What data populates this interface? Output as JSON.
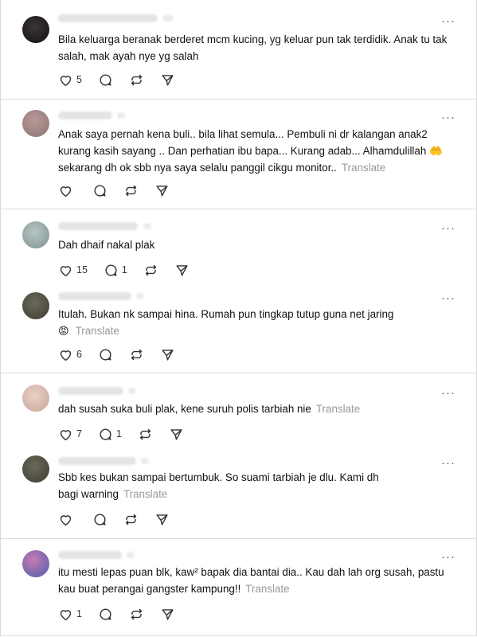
{
  "posts": [
    {
      "text": "Bila keluarga beranak berderet mcm kucing, yg keluar pun tak terdidik. Anak tu tak salah, mak ayah nye yg salah",
      "translate": "",
      "emoji": "",
      "like_count": "5",
      "reply_count": ""
    },
    {
      "text": "Anak saya pernah kena buli.. bila lihat semula... Pembuli ni dr kalangan anak2 kurang kasih sayang .. Dan perhatian ibu bapa... Kurang adab... Alhamdulillah 🤲 sekarang dh ok sbb nya saya selalu panggil cikgu monitor..",
      "translate": "Translate",
      "emoji": "",
      "like_count": "",
      "reply_count": ""
    },
    {
      "text": "Dah dhaif nakal plak",
      "translate": "",
      "emoji": "",
      "like_count": "15",
      "reply_count": "1"
    },
    {
      "text": "Itulah. Bukan nk sampai hina. Rumah pun tingkap tutup guna net jaring",
      "translate": "Translate",
      "emoji": "😡",
      "like_count": "6",
      "reply_count": ""
    },
    {
      "text": "dah susah suka buli plak, kene suruh polis tarbiah nie",
      "translate": "Translate",
      "emoji": "",
      "like_count": "7",
      "reply_count": "1"
    },
    {
      "text": "Sbb kes bukan sampai bertumbuk. So suami tarbiah je dlu. Kami dh bagi warning",
      "translate": "Translate",
      "emoji": "",
      "like_count": "",
      "reply_count": ""
    },
    {
      "text": "itu mesti lepas puan blk, kaw² bapak dia bantai dia.. Kau dah lah org susah, pastu kau buat perangai gangster kampung!!",
      "translate": "Translate",
      "emoji": "",
      "like_count": "1",
      "reply_count": ""
    }
  ],
  "more_label": "···",
  "icons": {
    "like": "heart-icon",
    "reply": "comment-bubble-icon",
    "repost": "repost-icon",
    "share": "send-icon",
    "more": "more-options-icon"
  },
  "colors": {
    "text": "#111111",
    "muted": "#999999",
    "divider": "#dcdcdc",
    "icon": "#333333"
  }
}
